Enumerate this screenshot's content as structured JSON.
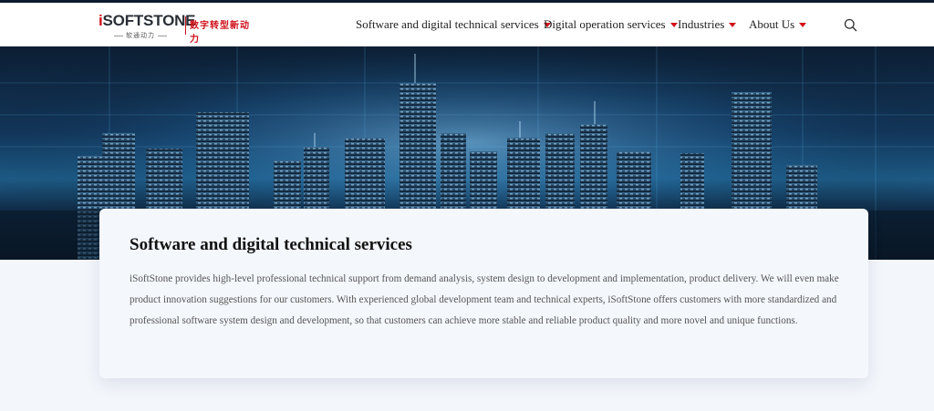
{
  "header": {
    "logo": {
      "initial": "i",
      "wordmark": "SOFTSTONE",
      "chinese_sub": "软通动力",
      "slogan": "数字转型新动力"
    },
    "nav": [
      {
        "label": "Software and digital technical services"
      },
      {
        "label": "Digital operation services"
      },
      {
        "label": "Industries"
      },
      {
        "label": "About Us"
      }
    ],
    "search_icon": "search-icon"
  },
  "hero": {
    "image": "city-skyline-night"
  },
  "card": {
    "title": "Software and digital technical services",
    "body": "iSoftStone provides high-level professional technical support from demand analysis, system design to development and implementation, product delivery. We will even make product innovation suggestions for our customers. With experienced global development team and technical experts, iSoftStone offers customers with more standardized and professional software system design and development, so that customers can achieve more stable and reliable product quality and more novel and unique functions."
  },
  "colors": {
    "accent": "#d0111b",
    "header_bg": "#ffffff",
    "page_bg": "#f3f6fb",
    "hero_dark": "#0c1e33",
    "hero_glow": "#5fb7ff"
  }
}
